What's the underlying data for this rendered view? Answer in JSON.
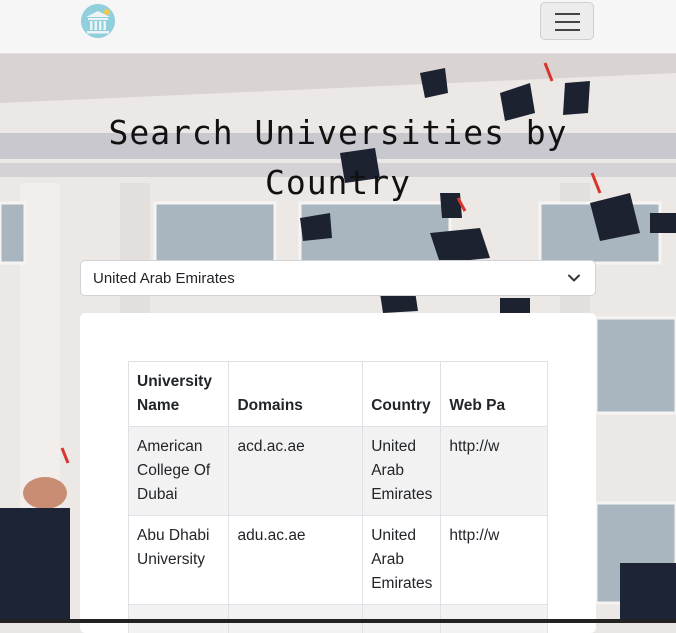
{
  "title": "Search Universities by Country",
  "country_select": {
    "value": "United Arab Emirates"
  },
  "table": {
    "headers": [
      "University Name",
      "Domains",
      "Country",
      "Web Pa"
    ],
    "rows": [
      [
        "American College Of Dubai",
        "acd.ac.ae",
        "United Arab Emirates",
        "http://w"
      ],
      [
        "Abu Dhabi University",
        "adu.ac.ae",
        "United Arab Emirates",
        "http://w"
      ]
    ]
  },
  "colors": {
    "navbar": "#f6f6f7",
    "card": "#ffffff",
    "stripe": "#f2f2f2",
    "logo": "#8fd0dc"
  },
  "icons": {
    "logo": "university-building-icon",
    "toggler": "hamburger-icon",
    "select": "chevron-down-icon"
  }
}
